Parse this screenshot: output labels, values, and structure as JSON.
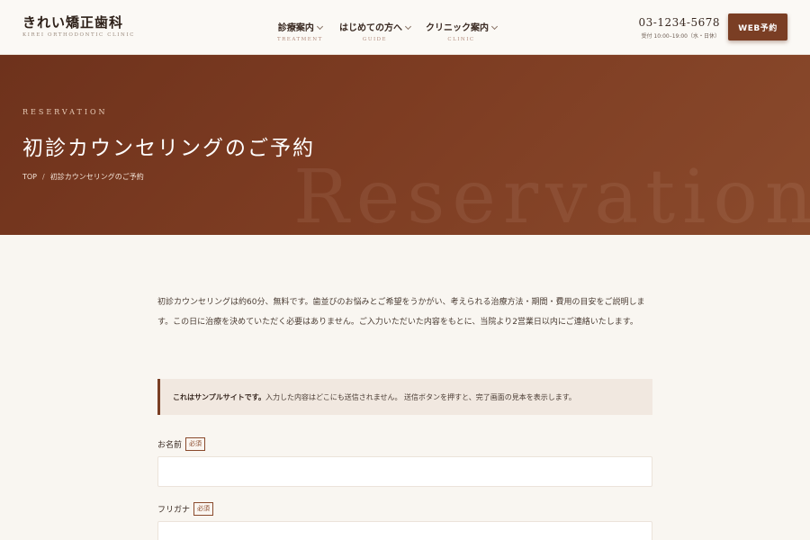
{
  "header": {
    "logo_main": "きれい矯正歯科",
    "logo_sub": "KIREI ORTHODONTIC CLINIC",
    "nav": [
      {
        "label": "診療案内",
        "sub": "TREATMENT"
      },
      {
        "label": "はじめての方へ",
        "sub": "GUIDE"
      },
      {
        "label": "クリニック案内",
        "sub": "CLINIC"
      }
    ],
    "phone": "03-1234-5678",
    "hours": "受付 10:00–19:00（水・日休）",
    "web_button": "WEB予約"
  },
  "hero": {
    "eyebrow": "RESERVATION",
    "title": "初診カウンセリングのご予約",
    "watermark": "Reservation",
    "breadcrumb": {
      "home": "TOP",
      "separator": "/",
      "current": "初診カウンセリングのご予約"
    }
  },
  "main": {
    "intro": "初診カウンセリングは約60分、無料です。歯並びのお悩みとご希望をうかがい、考えられる治療方法・期間・費用の目安をご説明します。この日に治療を決めていただく必要はありません。ご入力いただいた内容をもとに、当院より2営業日以内にご連絡いたします。",
    "notice_strong": "これはサンプルサイトです。",
    "notice_text": "入力した内容はどこにも送信されません。 送信ボタンを押すと、完了画面の見本を表示します。",
    "fields": [
      {
        "label": "お名前",
        "required": "必須",
        "value": ""
      },
      {
        "label": "フリガナ",
        "required": "必須",
        "value": ""
      }
    ]
  },
  "colors": {
    "accent": "#7a3e24",
    "hero_start": "#6e321c",
    "hero_end": "#8a4a2c",
    "background": "#f9f6f1"
  }
}
